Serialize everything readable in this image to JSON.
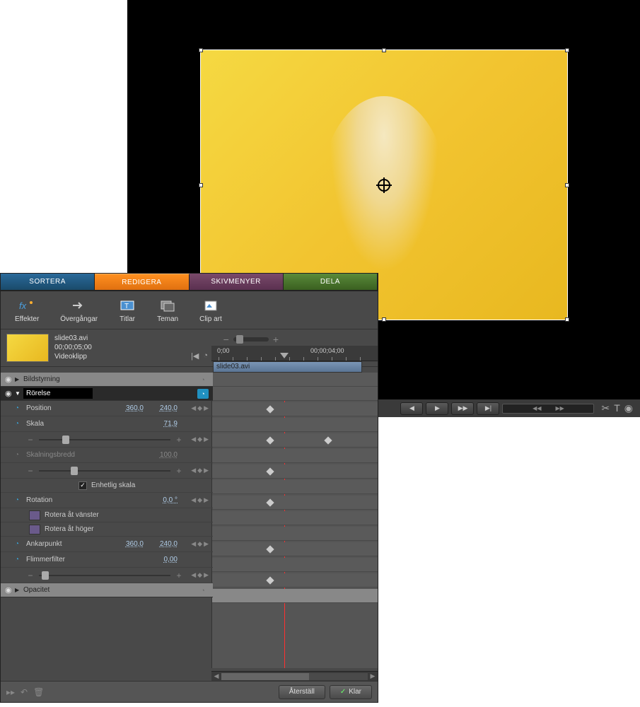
{
  "tabs": {
    "sortera": "SORTERA",
    "redigera": "REDIGERA",
    "skivmenyer": "SKIVMENYER",
    "dela": "DELA"
  },
  "toolbar": {
    "effekter": "Effekter",
    "overgangar": "Övergångar",
    "titlar": "Titlar",
    "teman": "Teman",
    "clipart": "Clip art"
  },
  "clip": {
    "name": "slide03.avi",
    "duration": "00;00;05;00",
    "type": "Videoklipp"
  },
  "timeline": {
    "t0": "0;00",
    "t4": "00;00;04;00",
    "clip_label": "slide03.avi"
  },
  "sections": {
    "bildstyrning": "Bildstyrning",
    "rorelse": "Rörelse",
    "opacitet": "Opacitet"
  },
  "props": {
    "position": {
      "label": "Position",
      "x": "360,0",
      "y": "240,0"
    },
    "skala": {
      "label": "Skala",
      "value": "71,9"
    },
    "skalningsbredd": {
      "label": "Skalningsbredd",
      "value": "100,0"
    },
    "enhetlig": "Enhetlig skala",
    "rotation": {
      "label": "Rotation",
      "value": "0,0 °"
    },
    "rotera_vanster": "Rotera åt vänster",
    "rotera_hoger": "Rotera åt höger",
    "ankarpunkt": {
      "label": "Ankarpunkt",
      "x": "360,0",
      "y": "240,0"
    },
    "flimmerfilter": {
      "label": "Flimmerfilter",
      "value": "0,00"
    }
  },
  "buttons": {
    "aterstall": "Återställ",
    "klar": "Klar"
  }
}
